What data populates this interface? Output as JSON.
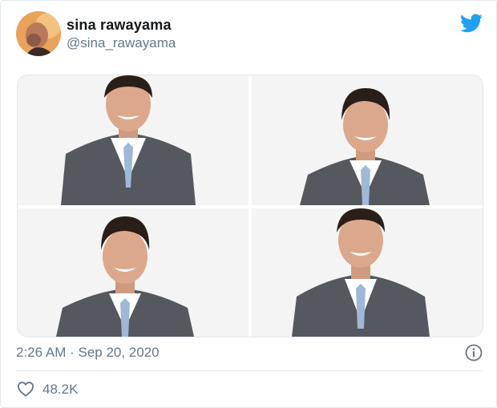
{
  "tweet": {
    "display_name": "sina rawayama",
    "handle": "@sina_rawayama",
    "timestamp": "2:26 AM · Sep 20, 2020",
    "likes": "48.2K"
  },
  "colors": {
    "brand": "#1da1f2",
    "secondary_text": "#657786",
    "primary_text": "#14171a"
  },
  "icons": [
    "twitter-bird-icon",
    "info-icon",
    "heart-icon"
  ],
  "media": {
    "photos": [
      {
        "id": "photo-1"
      },
      {
        "id": "photo-2"
      },
      {
        "id": "photo-3"
      },
      {
        "id": "photo-4"
      }
    ]
  }
}
